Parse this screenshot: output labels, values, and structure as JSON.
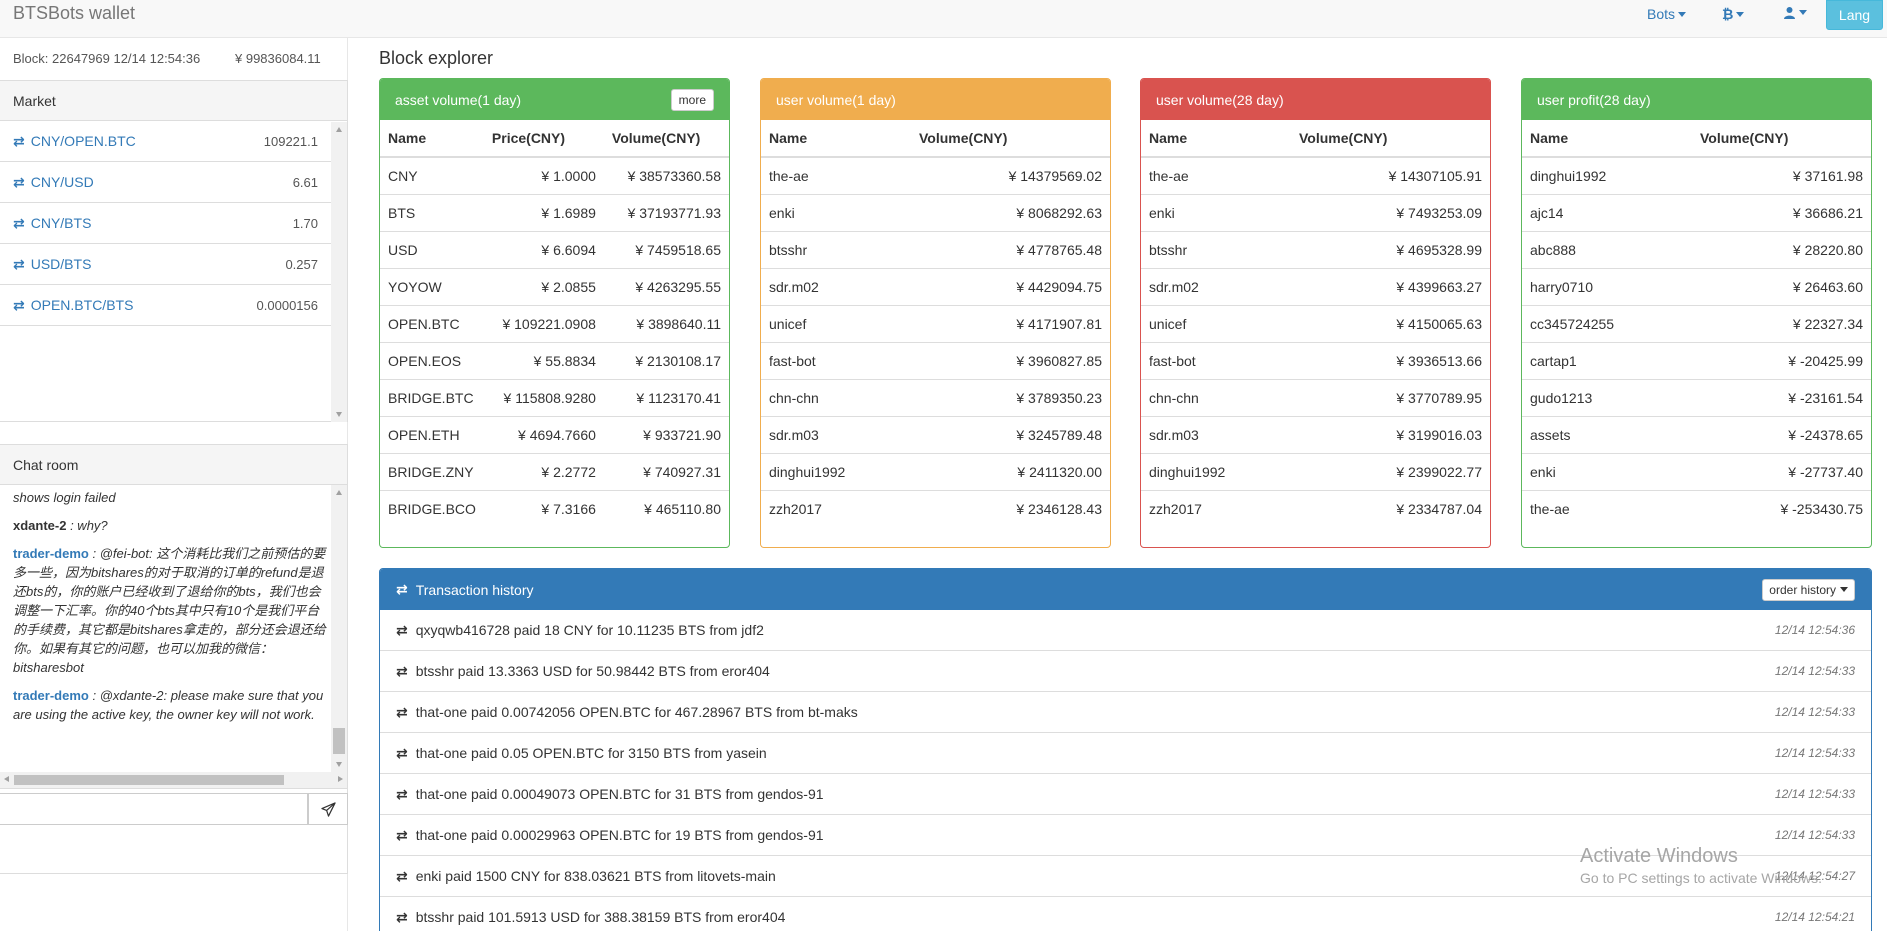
{
  "app": {
    "brand": "BTSBots wallet",
    "nav": {
      "bots": "Bots",
      "currency_icon": "₿",
      "user_icon": "user-icon",
      "lang": "Lang"
    }
  },
  "sidebar": {
    "block": "Block: 22647969 12/14 12:54:36",
    "balance": "¥  99836084.11",
    "market": {
      "title": "Market",
      "items": [
        {
          "pair": "CNY/OPEN.BTC",
          "value": "109221.1"
        },
        {
          "pair": "CNY/USD",
          "value": "6.61"
        },
        {
          "pair": "CNY/BTS",
          "value": "1.70"
        },
        {
          "pair": "USD/BTS",
          "value": "0.257"
        },
        {
          "pair": "OPEN.BTC/BTS",
          "value": "0.0000156"
        }
      ]
    },
    "chat": {
      "title": "Chat room",
      "messages": [
        {
          "user": "",
          "text": "shows login failed"
        },
        {
          "user": "xdante-2",
          "text": " : why?"
        },
        {
          "user": "trader-demo",
          "text": " : @fei-bot: 这个消耗比我们之前预估的要多一些，因为bitshares的对于取消的订单的refund是退还bts的，你的账户已经收到了退给你的bts，我们也会调整一下汇率。你的40个bts其中只有10个是我们平台的手续费，其它都是bitshares拿走的，部分还会退还给你。如果有其它的问题，也可以加我的微信：bitsharesbot"
        },
        {
          "user": "trader-demo",
          "text": " : @xdante-2: please make sure that you are using the active key, the owner key will not work."
        }
      ],
      "input_placeholder": ""
    }
  },
  "main": {
    "title": "Block explorer",
    "asset_volume": {
      "title": "asset volume(1 day)",
      "more": "more",
      "headers": [
        "Name",
        "Price(CNY)",
        "Volume(CNY)"
      ],
      "rows": [
        [
          "CNY",
          "¥ 1.0000",
          "¥ 38573360.58"
        ],
        [
          "BTS",
          "¥ 1.6989",
          "¥ 37193771.93"
        ],
        [
          "USD",
          "¥ 6.6094",
          "¥ 7459518.65"
        ],
        [
          "YOYOW",
          "¥ 2.0855",
          "¥ 4263295.55"
        ],
        [
          "OPEN.BTC",
          "¥ 109221.0908",
          "¥ 3898640.11"
        ],
        [
          "OPEN.EOS",
          "¥ 55.8834",
          "¥ 2130108.17"
        ],
        [
          "BRIDGE.BTC",
          "¥ 115808.9280",
          "¥ 1123170.41"
        ],
        [
          "OPEN.ETH",
          "¥ 4694.7660",
          "¥ 933721.90"
        ],
        [
          "BRIDGE.ZNY",
          "¥ 2.2772",
          "¥ 740927.31"
        ],
        [
          "BRIDGE.BCO",
          "¥ 7.3166",
          "¥ 465110.80"
        ]
      ]
    },
    "user_volume_1d": {
      "title": "user volume(1 day)",
      "headers": [
        "Name",
        "Volume(CNY)"
      ],
      "rows": [
        [
          "the-ae",
          "¥ 14379569.02"
        ],
        [
          "enki",
          "¥ 8068292.63"
        ],
        [
          "btsshr",
          "¥ 4778765.48"
        ],
        [
          "sdr.m02",
          "¥ 4429094.75"
        ],
        [
          "unicef",
          "¥ 4171907.81"
        ],
        [
          "fast-bot",
          "¥ 3960827.85"
        ],
        [
          "chn-chn",
          "¥ 3789350.23"
        ],
        [
          "sdr.m03",
          "¥ 3245789.48"
        ],
        [
          "dinghui1992",
          "¥ 2411320.00"
        ],
        [
          "zzh2017",
          "¥ 2346128.43"
        ]
      ]
    },
    "user_volume_28d": {
      "title": "user volume(28 day)",
      "headers": [
        "Name",
        "Volume(CNY)"
      ],
      "rows": [
        [
          "the-ae",
          "¥ 14307105.91"
        ],
        [
          "enki",
          "¥ 7493253.09"
        ],
        [
          "btsshr",
          "¥ 4695328.99"
        ],
        [
          "sdr.m02",
          "¥ 4399663.27"
        ],
        [
          "unicef",
          "¥ 4150065.63"
        ],
        [
          "fast-bot",
          "¥ 3936513.66"
        ],
        [
          "chn-chn",
          "¥ 3770789.95"
        ],
        [
          "sdr.m03",
          "¥ 3199016.03"
        ],
        [
          "dinghui1992",
          "¥ 2399022.77"
        ],
        [
          "zzh2017",
          "¥ 2334787.04"
        ]
      ]
    },
    "user_profit_28d": {
      "title": "user profit(28 day)",
      "headers": [
        "Name",
        "Volume(CNY)"
      ],
      "rows": [
        [
          "dinghui1992",
          "¥ 37161.98"
        ],
        [
          "ajc14",
          "¥ 36686.21"
        ],
        [
          "abc888",
          "¥ 28220.80"
        ],
        [
          "harry0710",
          "¥ 26463.60"
        ],
        [
          "cc345724255",
          "¥ 22327.34"
        ],
        [
          "cartap1",
          "¥ -20425.99"
        ],
        [
          "gudo1213",
          "¥ -23161.54"
        ],
        [
          "assets",
          "¥ -24378.65"
        ],
        [
          "enki",
          "¥ -27737.40"
        ],
        [
          "the-ae",
          "¥ -253430.75"
        ]
      ]
    },
    "transactions": {
      "title": "Transaction history",
      "order_history": "order history",
      "rows": [
        {
          "text": "qxyqwb416728 paid 18 CNY for 10.11235 BTS from jdf2",
          "time": "12/14 12:54:36"
        },
        {
          "text": "btsshr paid 13.3363 USD for 50.98442 BTS from eror404",
          "time": "12/14 12:54:33"
        },
        {
          "text": "that-one paid 0.00742056 OPEN.BTC for 467.28967 BTS from bt-maks",
          "time": "12/14 12:54:33"
        },
        {
          "text": "that-one paid 0.05 OPEN.BTC for 3150 BTS from yasein",
          "time": "12/14 12:54:33"
        },
        {
          "text": "that-one paid 0.00049073 OPEN.BTC for 31 BTS from gendos-91",
          "time": "12/14 12:54:33"
        },
        {
          "text": "that-one paid 0.00029963 OPEN.BTC for 19 BTS from gendos-91",
          "time": "12/14 12:54:33"
        },
        {
          "text": "enki paid 1500 CNY for 838.03621 BTS from litovets-main",
          "time": "12/14 12:54:27"
        },
        {
          "text": "btsshr paid 101.5913 USD for 388.38159 BTS from eror404",
          "time": "12/14 12:54:21"
        }
      ]
    }
  },
  "watermark": {
    "line1": "Activate Windows",
    "line2": "Go to PC settings to activate Windows."
  },
  "colors": {
    "green": "#5cb85c",
    "orange": "#f0ad4e",
    "red": "#d9534f",
    "blue": "#337ab7"
  }
}
